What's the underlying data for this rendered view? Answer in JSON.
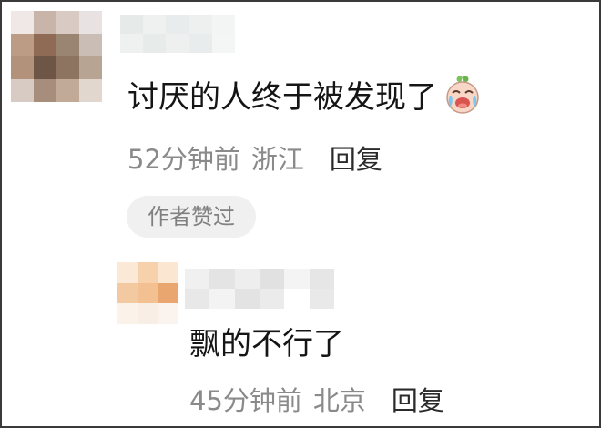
{
  "comment": {
    "text": "讨厌的人终于被发现了",
    "emoji_icon": "crying-laughing-face-icon",
    "time": "52分钟前",
    "location": "浙江",
    "reply_label": "回复",
    "author_badge": "作者赞过"
  },
  "reply": {
    "text": "飘的不行了",
    "time": "45分钟前",
    "location": "北京",
    "reply_label": "回复"
  }
}
